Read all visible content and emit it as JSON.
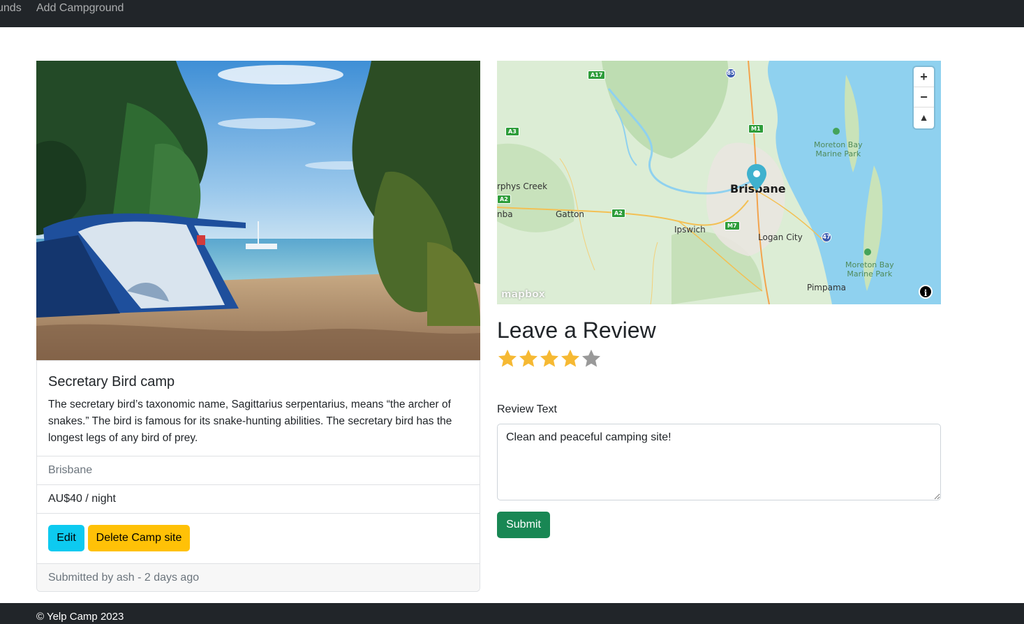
{
  "nav": {
    "links": [
      "All Campgrounds",
      "Add Campground"
    ],
    "visible_links": [
      "unds",
      "Add Campground"
    ]
  },
  "campground": {
    "title": "Secretary Bird camp",
    "description": "The secretary bird’s taxonomic name, Sagittarius serpentarius, means “the archer of snakes.” The bird is famous for its snake-hunting abilities. The secretary bird has the longest legs of any bird of prey.",
    "location": "Brisbane",
    "price": "AU$40 / night",
    "edit_label": "Edit",
    "delete_label": "Delete Camp site",
    "submitted": "Submitted by ash - 2 days ago"
  },
  "map": {
    "labels": {
      "brisbane": "Brisbane",
      "ipswich": "Ipswich",
      "logan": "Logan City",
      "gatton": "Gatton",
      "murphys": "rphys Creek",
      "toowoomba": "nba",
      "pimpama": "Pimpama",
      "moreton1": "Moreton Bay\nMarine Park",
      "moreton2": "Moreton Bay\nMarine Park"
    },
    "shields": {
      "a17": "A17",
      "a3": "A3",
      "a2a": "A2",
      "a2b": "A2",
      "m1": "M1",
      "m7": "M7",
      "s85": "85",
      "s47": "47"
    },
    "zoom_in": "+",
    "zoom_out": "−",
    "compass": "▲",
    "logo": "mapbox",
    "info": "i"
  },
  "review": {
    "heading": "Leave a Review",
    "rating": 4,
    "max_rating": 5,
    "text_label": "Review Text",
    "text_value": "Clean and peaceful camping site!",
    "submit_label": "Submit"
  },
  "colors": {
    "navbar": "#212529",
    "edit": "#0dcaf0",
    "delete": "#ffc107",
    "submit": "#198754",
    "star_filled": "#f6b933",
    "star_empty": "#999999"
  },
  "footer": {
    "text": "© Yelp Camp 2023"
  }
}
